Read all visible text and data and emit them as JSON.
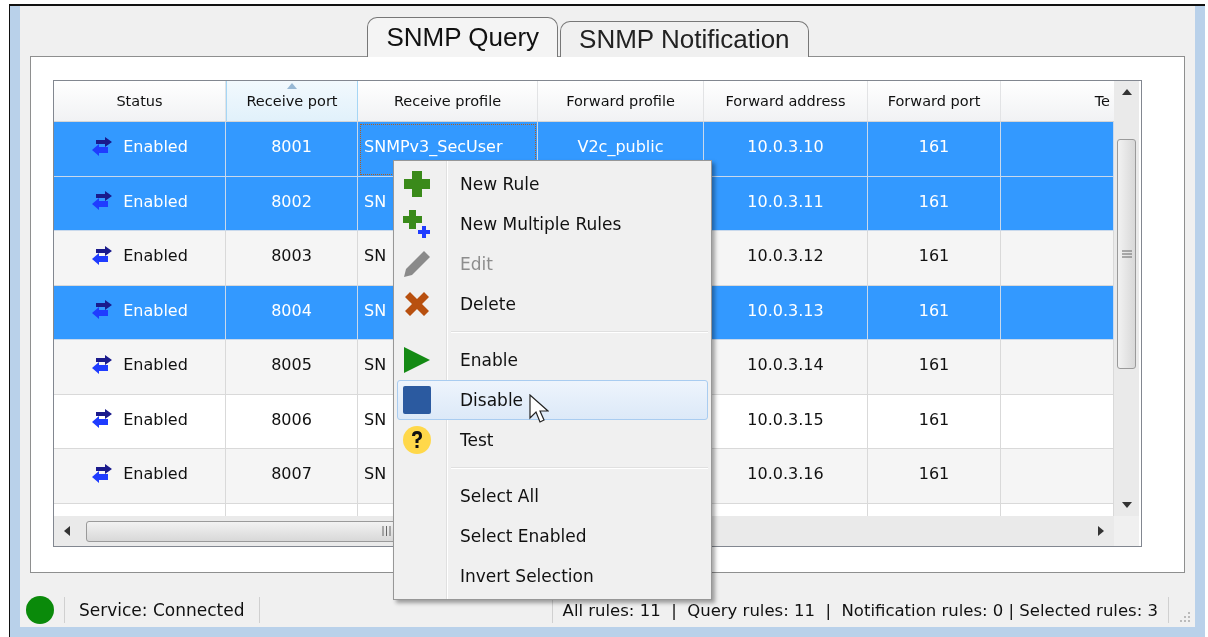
{
  "tabs": [
    {
      "label": "SNMP Query",
      "selected": true
    },
    {
      "label": "SNMP Notification",
      "selected": false
    }
  ],
  "table": {
    "columns": [
      {
        "label": "Status",
        "sorted": false
      },
      {
        "label": "Receive port",
        "sorted": true
      },
      {
        "label": "Receive profile",
        "sorted": false
      },
      {
        "label": "Forward profile",
        "sorted": false
      },
      {
        "label": "Forward address",
        "sorted": false
      },
      {
        "label": "Forward port",
        "sorted": false
      },
      {
        "label": "Te",
        "sorted": false
      }
    ],
    "rows": [
      {
        "selected": true,
        "focused": true,
        "status": "Enabled",
        "receive_port": "8001",
        "receive_profile": "SNMPv3_SecUser",
        "forward_profile": "V2c_public",
        "forward_address": "10.0.3.10",
        "forward_port": "161"
      },
      {
        "selected": true,
        "focused": false,
        "status": "Enabled",
        "receive_port": "8002",
        "receive_profile": "SN",
        "forward_address": "10.0.3.11",
        "forward_port": "161"
      },
      {
        "selected": false,
        "focused": false,
        "status": "Enabled",
        "receive_port": "8003",
        "receive_profile": "SN",
        "forward_address": "10.0.3.12",
        "forward_port": "161"
      },
      {
        "selected": true,
        "focused": false,
        "status": "Enabled",
        "receive_port": "8004",
        "receive_profile": "SN",
        "forward_address": "10.0.3.13",
        "forward_port": "161"
      },
      {
        "selected": false,
        "focused": false,
        "status": "Enabled",
        "receive_port": "8005",
        "receive_profile": "SN",
        "forward_address": "10.0.3.14",
        "forward_port": "161"
      },
      {
        "selected": false,
        "focused": false,
        "status": "Enabled",
        "receive_port": "8006",
        "receive_profile": "SN",
        "forward_address": "10.0.3.15",
        "forward_port": "161"
      },
      {
        "selected": false,
        "focused": false,
        "status": "Enabled",
        "receive_port": "8007",
        "receive_profile": "SN",
        "forward_address": "10.0.3.16",
        "forward_port": "161"
      }
    ]
  },
  "context_menu": {
    "groups": [
      [
        {
          "label": "New Rule",
          "disabled": false,
          "selected": false
        },
        {
          "label": "New Multiple Rules",
          "disabled": false,
          "selected": false
        },
        {
          "label": "Edit",
          "disabled": true,
          "selected": false
        },
        {
          "label": "Delete",
          "disabled": false,
          "selected": false
        }
      ],
      [
        {
          "label": "Enable",
          "disabled": false,
          "selected": false
        },
        {
          "label": "Disable",
          "disabled": false,
          "selected": true
        },
        {
          "label": "Test",
          "disabled": false,
          "selected": false
        }
      ],
      [
        {
          "label": "Select All",
          "disabled": false,
          "selected": false
        },
        {
          "label": "Select Enabled",
          "disabled": false,
          "selected": false
        },
        {
          "label": "Invert Selection",
          "disabled": false,
          "selected": false
        }
      ]
    ]
  },
  "status_bar": {
    "service": "Service: Connected",
    "summary": "All rules: 11  |  Query rules: 11  |  Notification rules: 0 | Selected rules: 3"
  }
}
